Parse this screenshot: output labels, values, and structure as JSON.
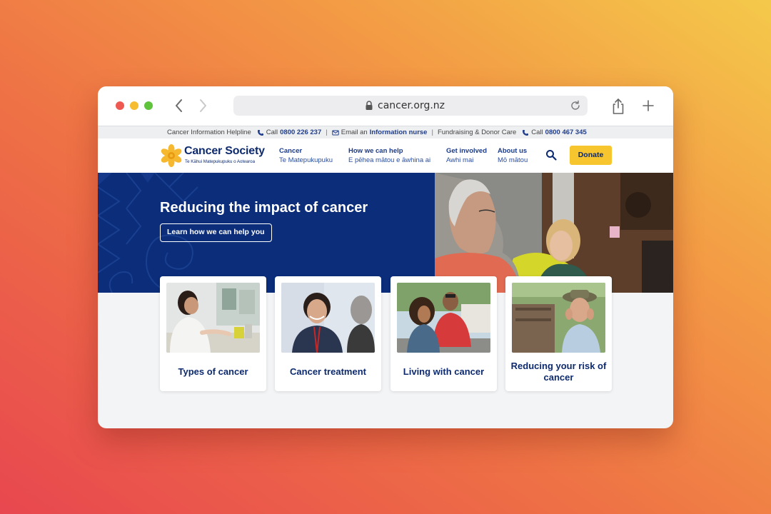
{
  "browser": {
    "url": "cancer.org.nz",
    "icons": [
      "back-arrow-icon",
      "forward-arrow-icon",
      "lock-icon",
      "reload-icon",
      "share-icon",
      "plus-icon"
    ]
  },
  "utility_bar": {
    "helpline_label": "Cancer Information Helpline",
    "call_label": "Call",
    "helpline_number": "0800 226 237",
    "sep": "|",
    "email_prefix": "Email an",
    "email_link": "Information nurse",
    "fundraising_label": "Fundraising & Donor Care",
    "call_label_2": "Call",
    "fundraising_number": "0800 467 345"
  },
  "site": {
    "logo_name": "Cancer Society",
    "logo_tagline": "Te Kāhui Matepukupuku o Aotearoa",
    "nav": [
      {
        "en": "Cancer",
        "mi": "Te Matepukupuku"
      },
      {
        "en": "How we can help",
        "mi": "E pēhea mātou e āwhina ai"
      },
      {
        "en": "Get involved",
        "mi": "Awhi mai"
      },
      {
        "en": "About us",
        "mi": "Mō mātou"
      }
    ],
    "donate_label": "Donate"
  },
  "hero": {
    "heading": "Reducing the impact of cancer",
    "cta_label": "Learn how we can help you"
  },
  "cards": [
    {
      "title": "Types of cancer"
    },
    {
      "title": "Cancer treatment"
    },
    {
      "title": "Living with cancer"
    },
    {
      "title": "Reducing your risk of cancer"
    }
  ],
  "colors": {
    "brand_navy": "#0b2d7a",
    "donate_yellow": "#f7c62f",
    "link_blue": "#1f3d8c"
  }
}
